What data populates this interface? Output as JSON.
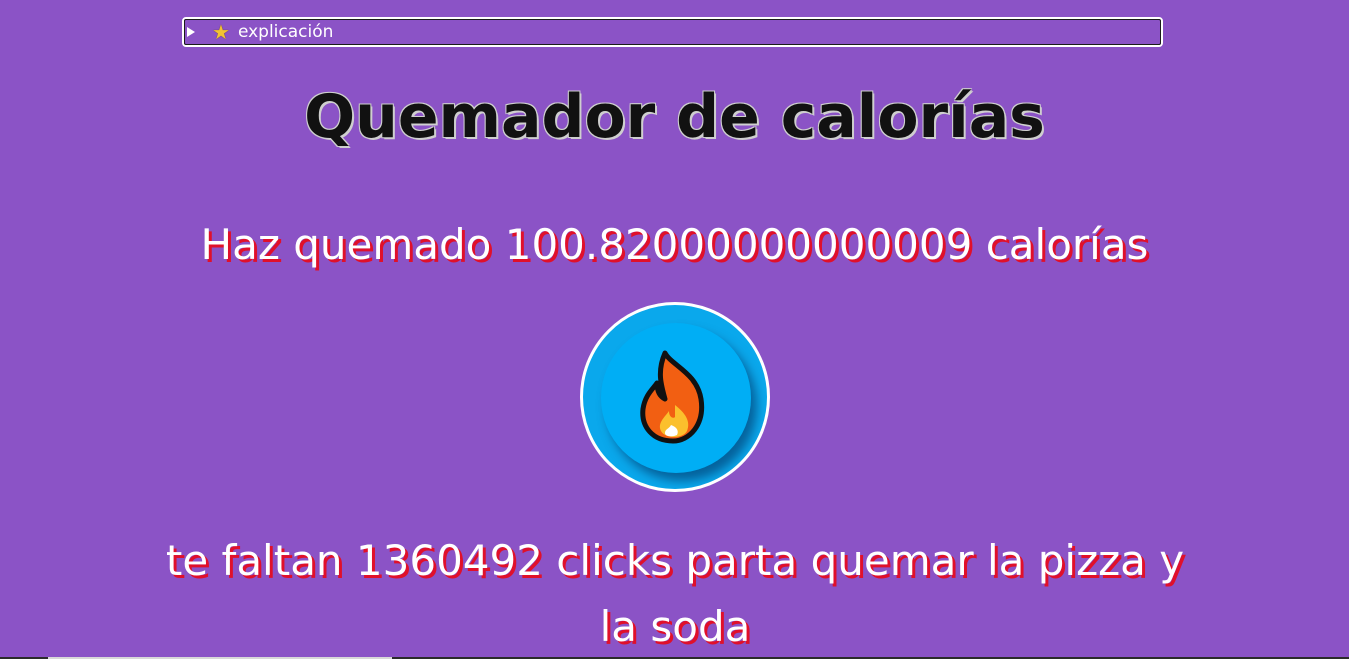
{
  "details": {
    "summary_label": "explicación",
    "icon": "star-icon"
  },
  "title": "Quemador de calorías",
  "burned_text": "Haz quemado 100.82000000000009 calorías",
  "burn_button": {
    "icon": "fire-icon",
    "colors": {
      "outer": "#0aa8ec",
      "inner": "#00aef5",
      "flame": "#f25f12",
      "flame_core": "#fbc02d"
    }
  },
  "remaining_text": "te faltan 1360492 clicks parta quemar la pizza y la soda",
  "colors": {
    "background": "#8b53c6",
    "text_shadow": "#e0102a",
    "text": "#ffffff"
  }
}
